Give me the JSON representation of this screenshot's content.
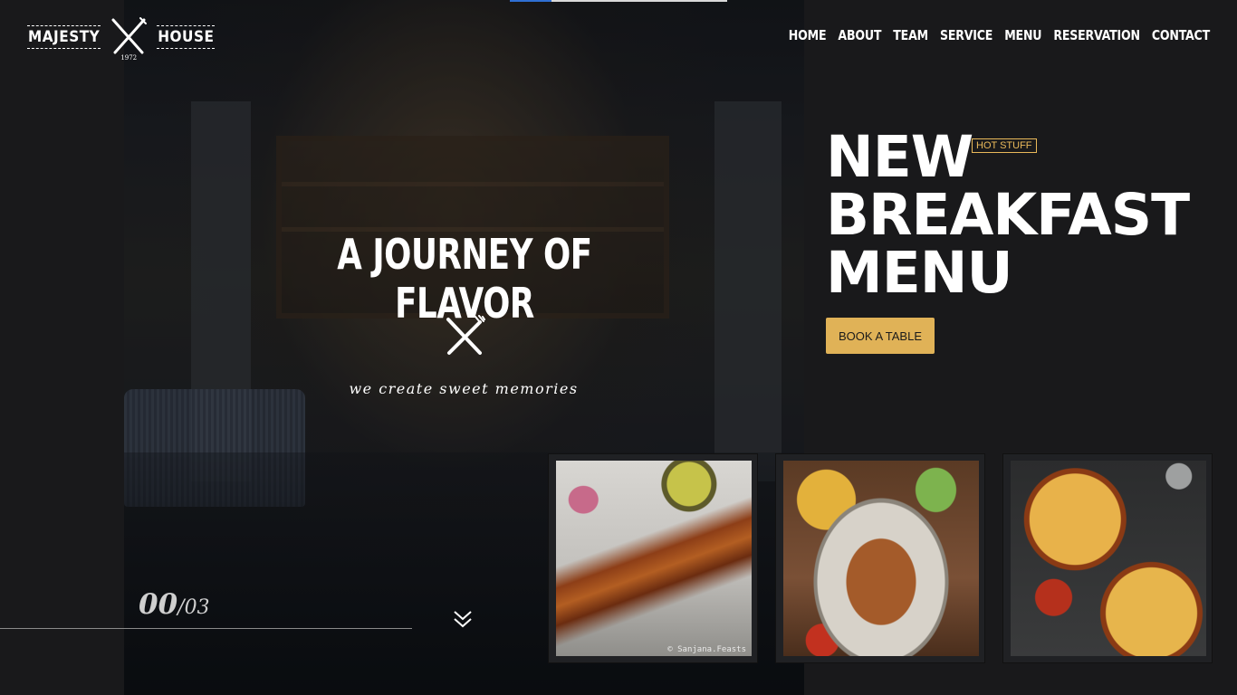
{
  "logo": {
    "left_word": "MAJESTY",
    "right_word": "HOUSE",
    "year": "1972"
  },
  "nav": {
    "items": [
      "HOME",
      "ABOUT",
      "TEAM",
      "SERVICE",
      "MENU",
      "RESERVATION",
      "CONTACT"
    ]
  },
  "slider": {
    "progress": 0.19
  },
  "hero": {
    "title": "A JOURNEY OF FLAVOR",
    "tagline": "we create sweet memories",
    "counter_current": "00",
    "counter_separator": "/",
    "counter_total": "03"
  },
  "promo": {
    "title_lines": [
      "NEW",
      "BREAKFAST",
      "MENU"
    ],
    "badge": "HOT STUFF",
    "button": "BOOK A TABLE"
  },
  "gallery": [
    {
      "name": "kebab-skewers-card",
      "watermark": "© Sanjana.Feasts"
    },
    {
      "name": "chaat-plate-card"
    },
    {
      "name": "pizzas-card"
    }
  ],
  "colors": {
    "accent": "#e0b257",
    "background": "#19191b",
    "progress": "#2f6fd3"
  }
}
